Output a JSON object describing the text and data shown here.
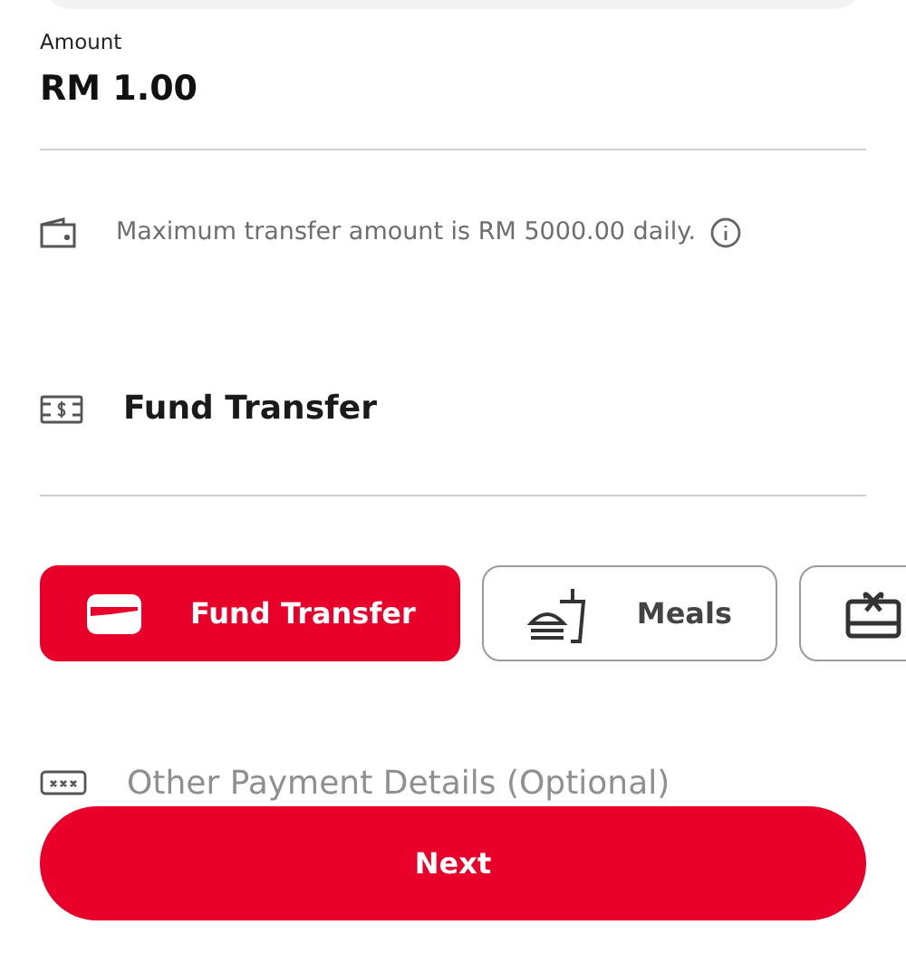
{
  "amount": {
    "label": "Amount",
    "value": "RM 1.00"
  },
  "limit_note": "Maximum transfer amount is RM 5000.00 daily.",
  "purpose": {
    "value": "Fund Transfer"
  },
  "categories": [
    {
      "kind": "card",
      "label": "Fund Transfer",
      "selected": true
    },
    {
      "kind": "meal",
      "label": "Meals",
      "selected": false
    },
    {
      "kind": "gift",
      "selected": false
    }
  ],
  "details": {
    "placeholder": "Other Payment Details (Optional)"
  },
  "next_button": "Next"
}
